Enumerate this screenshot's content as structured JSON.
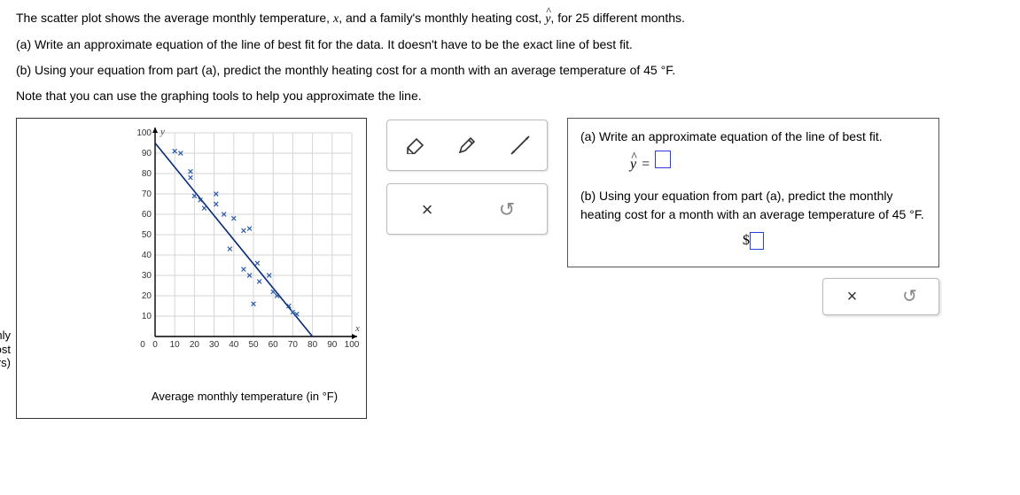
{
  "problem": {
    "intro_pre": "The scatter plot shows the average monthly temperature, ",
    "intro_mid": ", and a family's monthly heating cost, ",
    "intro_post": ", for 25 different months.",
    "part_a": "(a) Write an approximate equation of the line of best fit for the data. It doesn't have to be the exact line of best fit.",
    "part_b_pre": "(b) Using your equation from part (a), predict the monthly heating cost for a month with an average temperature of ",
    "part_b_temp": "45 °F",
    "part_b_post": ".",
    "note": "Note that you can use the graphing tools to help you approximate the line."
  },
  "chart_data": {
    "type": "scatter",
    "title": "",
    "xlabel": "Average monthly temperature (in °F)",
    "ylabel_lines": [
      "Monthly",
      "heating cost",
      "(in dollars)"
    ],
    "xlim": [
      0,
      100
    ],
    "ylim": [
      0,
      100
    ],
    "xticks": [
      0,
      10,
      20,
      30,
      40,
      50,
      60,
      70,
      80,
      90,
      100
    ],
    "yticks": [
      10,
      20,
      30,
      40,
      50,
      60,
      70,
      80,
      90,
      100
    ],
    "x_axis_var": "x",
    "y_axis_var": "y",
    "points": [
      {
        "x": 10,
        "y": 91
      },
      {
        "x": 13,
        "y": 90
      },
      {
        "x": 18,
        "y": 81
      },
      {
        "x": 18,
        "y": 78
      },
      {
        "x": 20,
        "y": 69
      },
      {
        "x": 23,
        "y": 67
      },
      {
        "x": 25,
        "y": 63
      },
      {
        "x": 31,
        "y": 70
      },
      {
        "x": 31,
        "y": 65
      },
      {
        "x": 35,
        "y": 60
      },
      {
        "x": 40,
        "y": 58
      },
      {
        "x": 45,
        "y": 52
      },
      {
        "x": 48,
        "y": 53
      },
      {
        "x": 38,
        "y": 43
      },
      {
        "x": 45,
        "y": 33
      },
      {
        "x": 48,
        "y": 30
      },
      {
        "x": 52,
        "y": 36
      },
      {
        "x": 53,
        "y": 27
      },
      {
        "x": 58,
        "y": 30
      },
      {
        "x": 50,
        "y": 16
      },
      {
        "x": 60,
        "y": 22
      },
      {
        "x": 62,
        "y": 20
      },
      {
        "x": 68,
        "y": 15
      },
      {
        "x": 70,
        "y": 12
      },
      {
        "x": 72,
        "y": 11
      }
    ],
    "best_fit_line": {
      "x1": 0,
      "y1": 95,
      "x2": 80,
      "y2": 0
    }
  },
  "answers": {
    "a_prompt": "(a) Write an approximate equation of the line of best fit.",
    "a_eq_left": "=",
    "b_prompt_pre": "(b) Using your equation from part (a), predict the monthly heating cost for a month with an average temperature of ",
    "b_prompt_temp": "45 °F",
    "b_prompt_post": ".",
    "dollar": "$"
  },
  "icons": {
    "eraser": "eraser",
    "pencil": "pencil",
    "line": "line",
    "close": "×",
    "undo": "↺"
  }
}
